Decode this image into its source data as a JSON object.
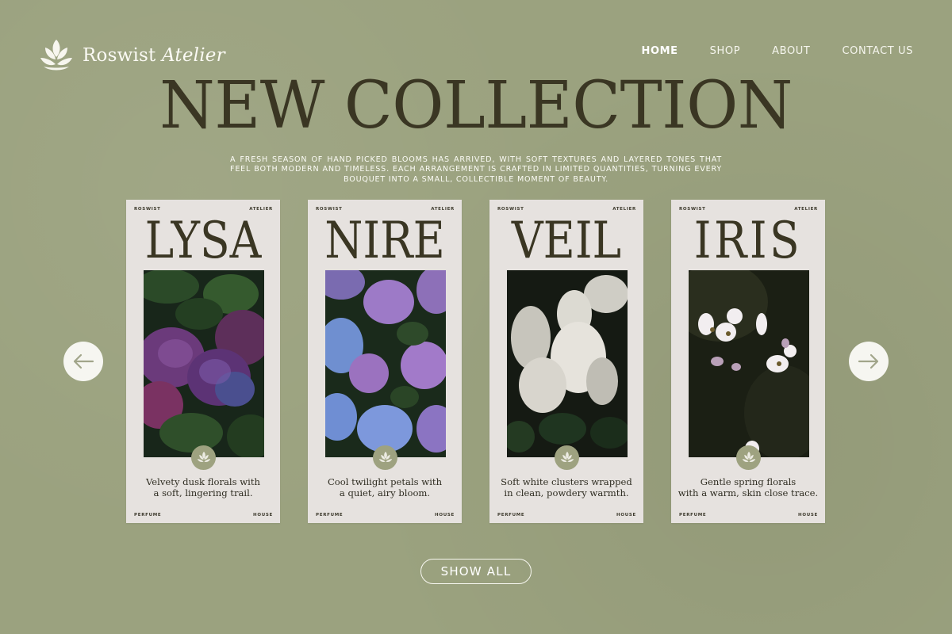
{
  "brand": {
    "name": "Roswist",
    "name_suffix": "Atelier"
  },
  "nav": {
    "items": [
      {
        "label": "HOME",
        "active": true
      },
      {
        "label": "SHOP",
        "active": false
      },
      {
        "label": "ABOUT",
        "active": false
      },
      {
        "label": "CONTACT US",
        "active": false
      }
    ]
  },
  "hero": {
    "title": "NEW COLLECTION",
    "description": "A fresh season of hand picked blooms has arrived, with soft textures and layered tones that feel both modern and timeless. Each arrangement is crafted in limited quantities, turning every bouquet into a small, collectible moment of beauty."
  },
  "cards": [
    {
      "top_left": "ROSWIST",
      "top_right": "ATELIER",
      "name": "LYSA",
      "desc_line1": "Velvety dusk florals with",
      "desc_line2": "a soft, lingering trail.",
      "bottom_left": "PERFUME",
      "bottom_right": "HOUSE",
      "photo_theme": "purple-hydrangea"
    },
    {
      "top_left": "ROSWIST",
      "top_right": "ATELIER",
      "name": "NIRE",
      "desc_line1": "Cool twilight petals with",
      "desc_line2": "a quiet, airy bloom.",
      "bottom_left": "PERFUME",
      "bottom_right": "HOUSE",
      "photo_theme": "blue-violet-hydrangea"
    },
    {
      "top_left": "ROSWIST",
      "top_right": "ATELIER",
      "name": "VEIL",
      "desc_line1": "Soft white clusters wrapped",
      "desc_line2": "in clean, powdery warmth.",
      "bottom_left": "PERFUME",
      "bottom_right": "HOUSE",
      "photo_theme": "white-hydrangea"
    },
    {
      "top_left": "ROSWIST",
      "top_right": "ATELIER",
      "name": "IRIS",
      "desc_line1": "Gentle spring florals",
      "desc_line2": "with a warm, skin close trace.",
      "bottom_left": "PERFUME",
      "bottom_right": "HOUSE",
      "photo_theme": "white-anemone"
    }
  ],
  "controls": {
    "prev_icon": "arrow-left-icon",
    "next_icon": "arrow-right-icon",
    "show_all_label": "SHOW ALL"
  },
  "colors": {
    "background": "#9ba27f",
    "headline": "#3a3623",
    "card": "#e6e2df",
    "badge": "#9ea280"
  }
}
